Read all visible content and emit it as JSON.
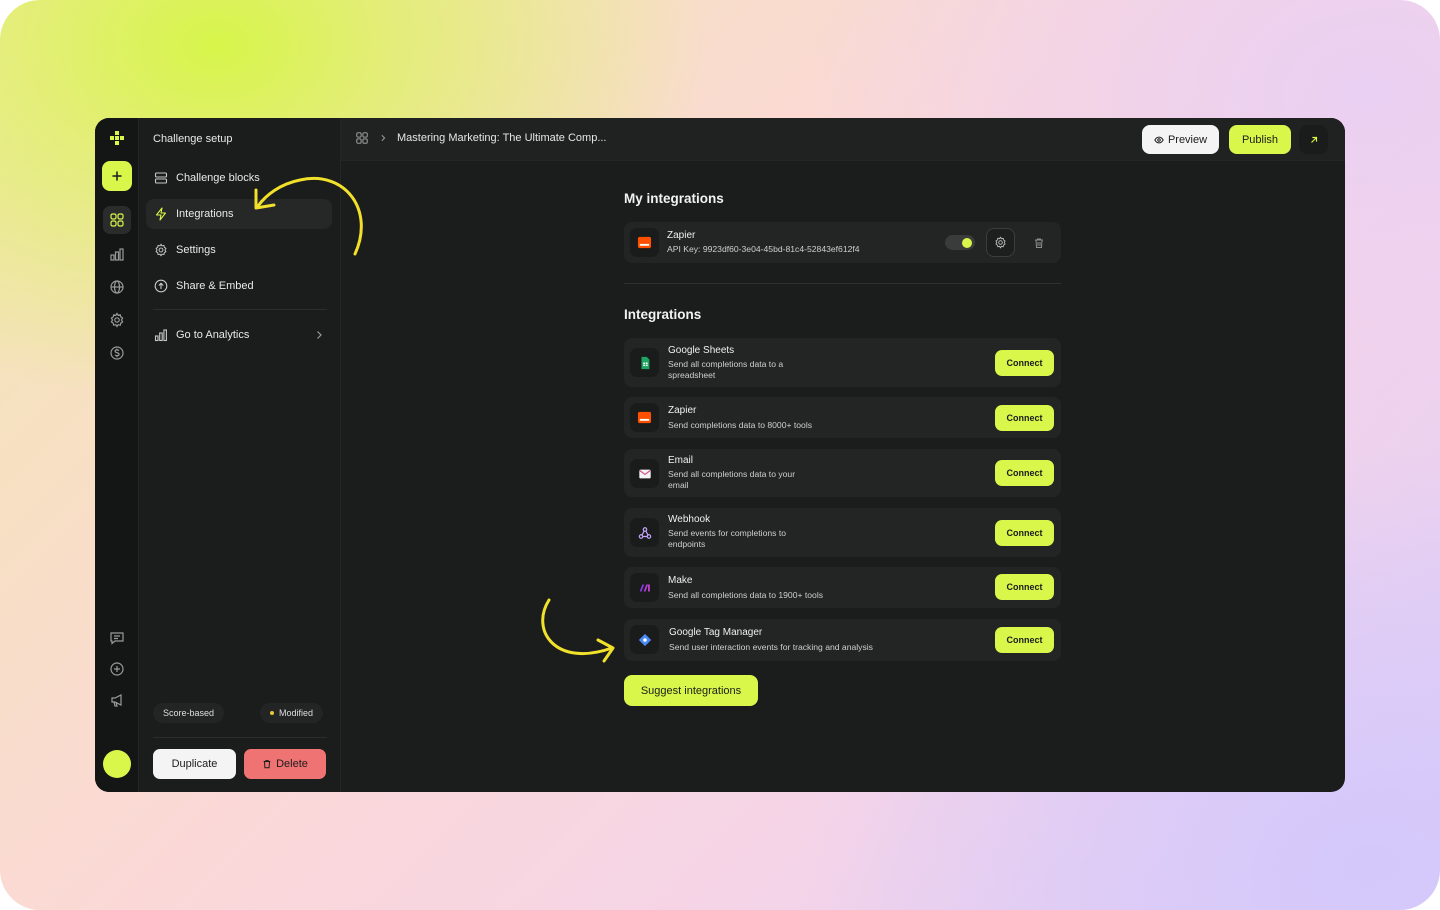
{
  "colors": {
    "accent": "#d9f64a",
    "danger": "#f07373",
    "bg": "#1b1c1c",
    "arrow": "#f2e12b"
  },
  "sidebar": {
    "title": "Challenge setup",
    "items": [
      {
        "label": "Challenge blocks",
        "icon": "blocks-icon"
      },
      {
        "label": "Integrations",
        "icon": "lightning-icon",
        "active": true
      },
      {
        "label": "Settings",
        "icon": "gear-icon"
      },
      {
        "label": "Share & Embed",
        "icon": "upload-icon"
      }
    ],
    "analytics_label": "Go to Analytics",
    "tags": {
      "type": "Score-based",
      "status": "Modified"
    },
    "duplicate_label": "Duplicate",
    "delete_label": "Delete"
  },
  "topbar": {
    "breadcrumb": "Mastering Marketing: The Ultimate Comp...",
    "preview_label": "Preview",
    "publish_label": "Publish"
  },
  "my_integrations": {
    "heading": "My integrations",
    "items": [
      {
        "name": "Zapier",
        "detail": "API Key: 9923df60-3e04-45bd-81c4-52843ef612f4",
        "enabled": true
      }
    ]
  },
  "integrations": {
    "heading": "Integrations",
    "connect_label": "Connect",
    "items": [
      {
        "name": "Google Sheets",
        "desc1": "Send all completions data to a",
        "desc2": "spreadsheet",
        "icon": "google-sheets-icon"
      },
      {
        "name": "Zapier",
        "desc1": "Send completions data to 8000+ tools",
        "desc2": "",
        "icon": "zapier-icon"
      },
      {
        "name": "Email",
        "desc1": "Send all completions data to your",
        "desc2": "email",
        "icon": "envelope-icon"
      },
      {
        "name": "Webhook",
        "desc1": "Send events for completions to",
        "desc2": "endpoints",
        "icon": "webhook-icon"
      },
      {
        "name": "Make",
        "desc1": "Send all completions data to 1900+ tools",
        "desc2": "",
        "icon": "make-icon"
      },
      {
        "name": "Google Tag Manager",
        "desc1": "Send user interaction events for tracking and analysis",
        "desc2": "",
        "icon": "google-tag-manager-icon"
      }
    ],
    "suggest_label": "Suggest integrations"
  }
}
